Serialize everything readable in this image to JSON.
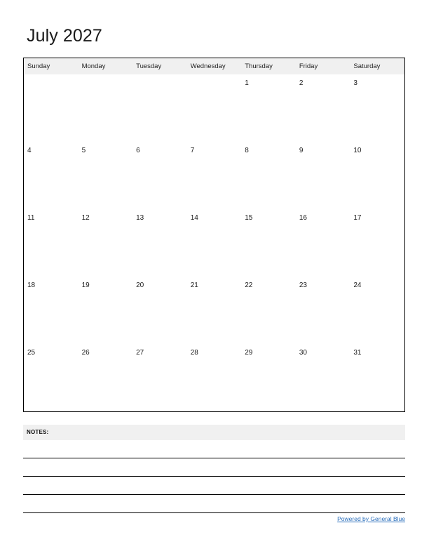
{
  "document": {
    "title": "July 2027",
    "month": "July",
    "year": "2027"
  },
  "calendar": {
    "weekday_headers": [
      "Sunday",
      "Monday",
      "Tuesday",
      "Wednesday",
      "Thursday",
      "Friday",
      "Saturday"
    ],
    "header_background": "#f0f0f0",
    "border_color": "#000000",
    "weeks": [
      [
        "",
        "",
        "",
        "",
        "1",
        "2",
        "3"
      ],
      [
        "4",
        "5",
        "6",
        "7",
        "8",
        "9",
        "10"
      ],
      [
        "11",
        "12",
        "13",
        "14",
        "15",
        "16",
        "17"
      ],
      [
        "18",
        "19",
        "20",
        "21",
        "22",
        "23",
        "24"
      ],
      [
        "25",
        "26",
        "27",
        "28",
        "29",
        "30",
        "31"
      ]
    ]
  },
  "notes": {
    "label": "NOTES:",
    "background": "#f0f0f0",
    "line_count": 4
  },
  "footer": {
    "link_text": "Powered by General Blue",
    "link_color": "#2a6ebb"
  }
}
